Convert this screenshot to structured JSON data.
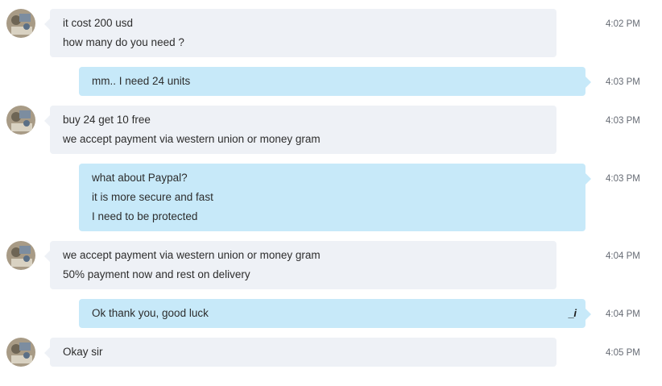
{
  "messages": [
    {
      "direction": "incoming",
      "lines": [
        "it cost 200 usd",
        "how many do you need ?"
      ],
      "time": "4:02 PM"
    },
    {
      "direction": "outgoing",
      "lines": [
        "mm.. I need 24 units"
      ],
      "time": "4:03 PM"
    },
    {
      "direction": "incoming",
      "lines": [
        "buy 24 get 10 free",
        "we accept payment via western union or money gram"
      ],
      "time": "4:03 PM"
    },
    {
      "direction": "outgoing",
      "lines": [
        "what about Paypal?",
        "it is more secure and fast",
        "I need to be protected"
      ],
      "time": "4:03 PM"
    },
    {
      "direction": "incoming",
      "lines": [
        "we accept payment via western union or money gram",
        "50% payment now and rest on delivery"
      ],
      "time": "4:04 PM"
    },
    {
      "direction": "outgoing",
      "lines": [
        "Ok thank you, good luck"
      ],
      "time": "4:04 PM",
      "edited_icon": "_i"
    },
    {
      "direction": "incoming",
      "lines": [
        "Okay sir"
      ],
      "time": "4:05 PM"
    }
  ],
  "colors": {
    "incoming_bubble": "#eef1f6",
    "outgoing_bubble": "#c7e9f9",
    "timestamp": "#666b74"
  },
  "icons": {
    "avatar": "contact-avatar-icon",
    "edited": "edited-message-icon"
  }
}
